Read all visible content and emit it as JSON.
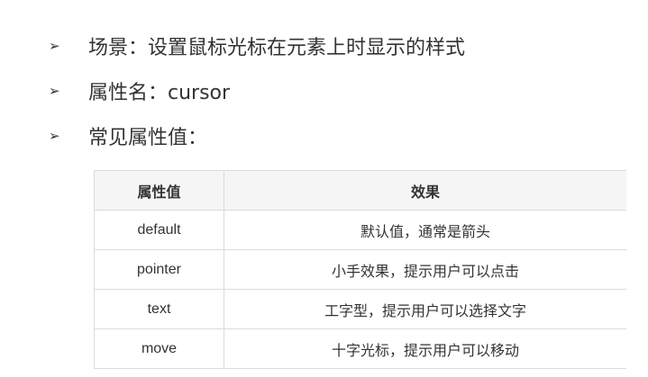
{
  "bullets": [
    {
      "marker": "➢",
      "text": "场景：设置鼠标光标在元素上时显示的样式"
    },
    {
      "marker": "➢",
      "text": "属性名：cursor"
    },
    {
      "marker": "➢",
      "text": "常见属性值："
    }
  ],
  "table": {
    "headers": [
      "属性值",
      "效果"
    ],
    "rows": [
      [
        "default",
        "默认值，通常是箭头"
      ],
      [
        "pointer",
        "小手效果，提示用户可以点击"
      ],
      [
        "text",
        "工字型，提示用户可以选择文字"
      ],
      [
        "move",
        "十字光标，提示用户可以移动"
      ]
    ]
  },
  "colors": {
    "text": "#333333",
    "header_bg": "#f5f5f5",
    "border": "#dcdcdc"
  }
}
